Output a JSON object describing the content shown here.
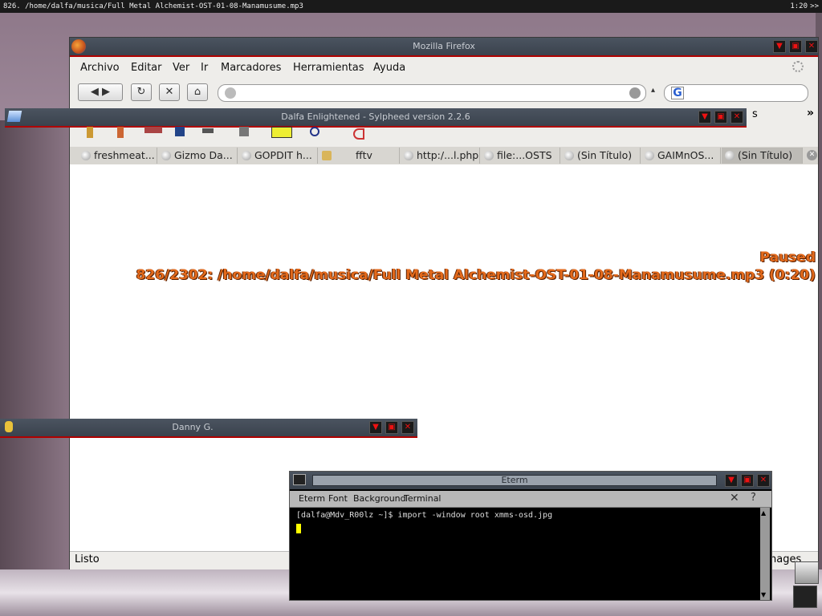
{
  "topbar": {
    "track": "826. /home/dalfa/musica/Full Metal Alchemist-OST-01-08-Manamusume.mp3",
    "clock": "1:20",
    "arrows": ">>"
  },
  "firefox": {
    "title": "Mozilla Firefox",
    "menu": [
      "Archivo",
      "Editar",
      "Ver",
      "Ir",
      "Marcadores",
      "Herramientas",
      "Ayuda"
    ],
    "status": "Listo",
    "status_right": "nages",
    "bookmarks_overflow": "»",
    "bookmarks_partial": "s",
    "tabs": [
      {
        "label": "freshmeat..."
      },
      {
        "label": "Gizmo Da..."
      },
      {
        "label": "GOPDIT h..."
      },
      {
        "label": "fftv"
      },
      {
        "label": "http:/...l.php"
      },
      {
        "label": "file:...OSTS"
      },
      {
        "label": "(Sin Título)"
      },
      {
        "label": "GAIMnOS..."
      },
      {
        "label": "(Sin Título)"
      }
    ]
  },
  "sylpheed": {
    "title": "Dalfa Enlightened - Sylpheed version 2.2.6"
  },
  "danny": {
    "title": "Danny G."
  },
  "osd": {
    "line1": "Paused",
    "line2": "826/2302: /home/dalfa/musica/Full Metal Alchemist-OST-01-08-Manamusume.mp3 (0:20)"
  },
  "eterm": {
    "title": "Eterm",
    "menu": [
      "Eterm",
      "Font",
      "Background",
      "Terminal"
    ],
    "prompt": "[dalfa@Mdv_R00lz ~]$ import -window root xmms-osd.jpg"
  },
  "colors": {
    "osd": "#e36a1c",
    "close": "#b00000"
  }
}
